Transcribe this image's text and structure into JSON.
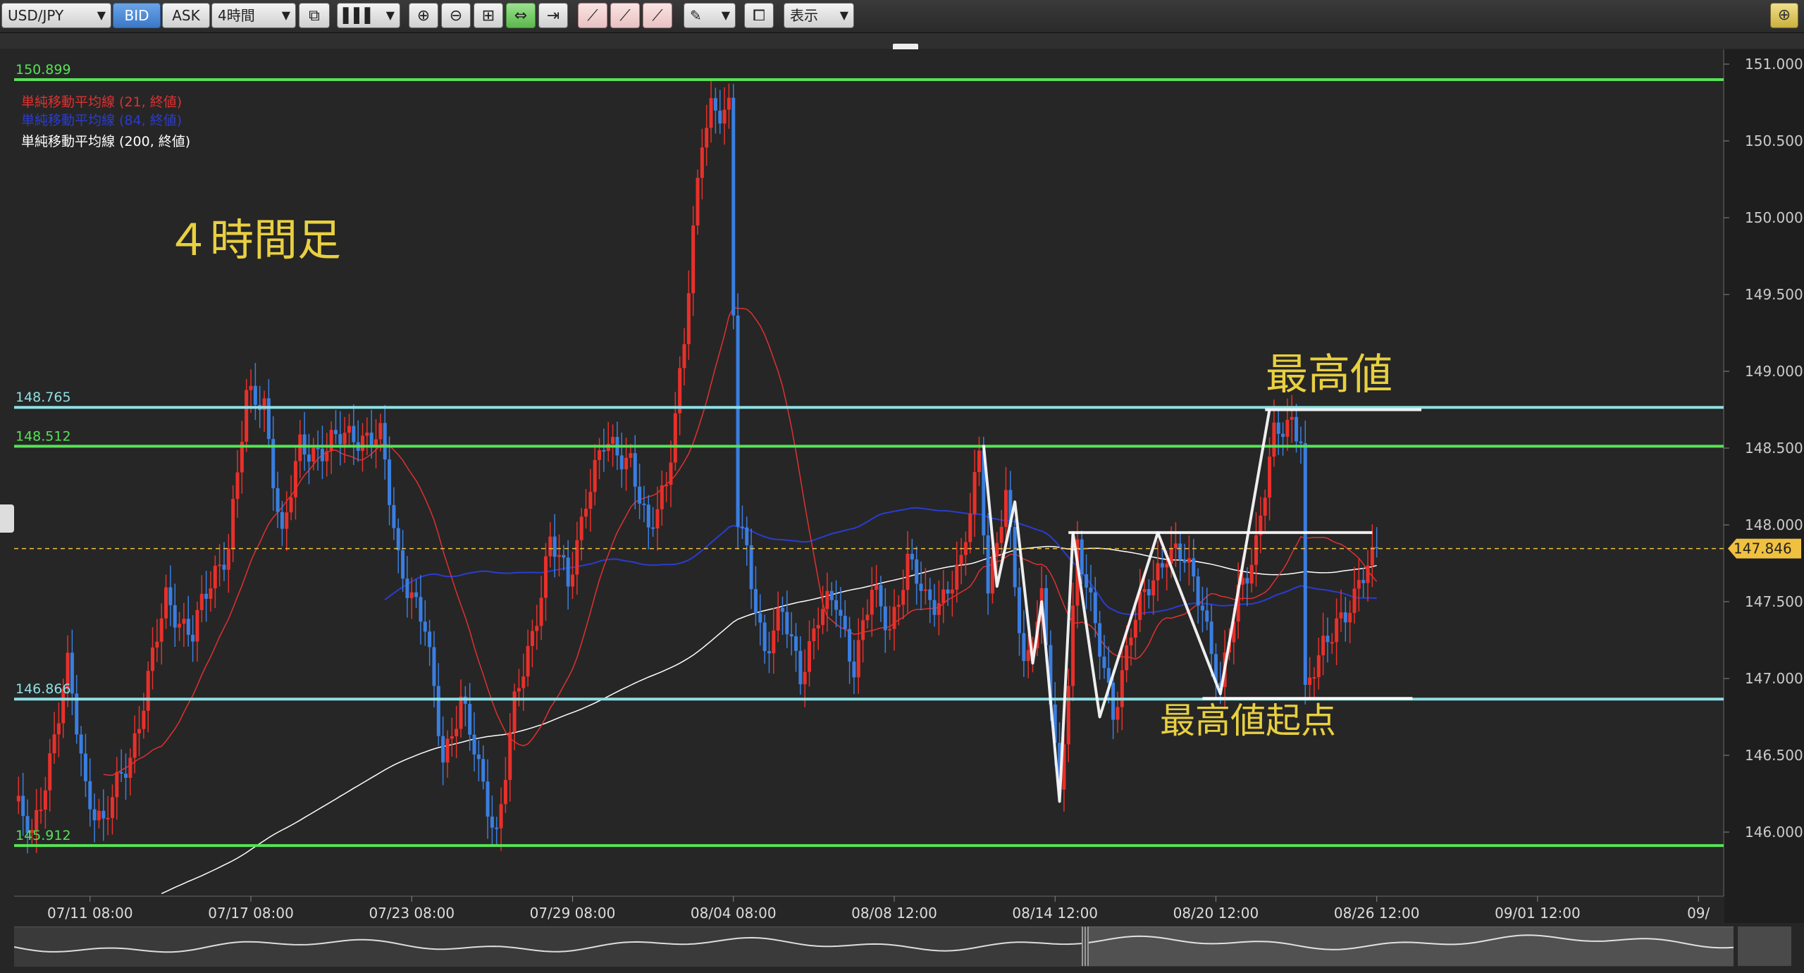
{
  "toolbar": {
    "symbol": "USD/JPY",
    "bid_label": "BID",
    "ask_label": "ASK",
    "timeframe": "4時間",
    "display_label": "表示",
    "icons": [
      "compare-icon",
      "chart-type-icon",
      "zoom-in-icon",
      "zoom-out-icon",
      "fit-icon",
      "range-icon",
      "pan-icon",
      "draw-tool-icon",
      "draw-tool-icon",
      "draw-tool-icon",
      "pencil-icon",
      "screenshot-icon",
      "settings-icon"
    ]
  },
  "legend": [
    {
      "label": "単純移動平均線 (21, 終値)",
      "color": "#e03030"
    },
    {
      "label": "単純移動平均線 (84, 終値)",
      "color": "#2a3cd0"
    },
    {
      "label": "単純移動平均線 (200, 終値)",
      "color": "#ffffff"
    }
  ],
  "annotations": {
    "timeframe_title": "４時間足",
    "high_label": "最高値",
    "high_origin_label": "最高値起点"
  },
  "colors": {
    "bull": "#e8302a",
    "bear": "#3a7ee0",
    "level_green": "#56e356",
    "level_cyan": "#8ee0e4",
    "annotation_text": "#e8d040",
    "current_price": "#f0c040"
  },
  "chart_data": {
    "type": "candlestick",
    "pair": "USD/JPY",
    "timeframe": "4時間",
    "ylim": [
      145.6,
      151.0
    ],
    "y_ticks": [
      "151.000",
      "150.500",
      "150.000",
      "149.500",
      "149.000",
      "148.500",
      "148.000",
      "147.500",
      "147.000",
      "146.500",
      "146.000"
    ],
    "x_ticks": [
      {
        "label": "07/11 08:00",
        "bar": 17
      },
      {
        "label": "07/17 08:00",
        "bar": 53
      },
      {
        "label": "07/23 08:00",
        "bar": 89
      },
      {
        "label": "07/29 08:00",
        "bar": 125
      },
      {
        "label": "08/04 08:00",
        "bar": 161
      },
      {
        "label": "08/08 12:00",
        "bar": 197
      },
      {
        "label": "08/14 12:00",
        "bar": 233
      },
      {
        "label": "08/20 12:00",
        "bar": 269
      },
      {
        "label": "08/26 12:00",
        "bar": 305
      },
      {
        "label": "09/01 12:00",
        "bar": 341
      },
      {
        "label": "09/",
        "bar": 377
      }
    ],
    "horizontal_levels": [
      {
        "label": "150.899",
        "value": 150.899,
        "color": "green"
      },
      {
        "label": "148.765",
        "value": 148.765,
        "color": "cyan"
      },
      {
        "label": "148.512",
        "value": 148.512,
        "color": "green"
      },
      {
        "label": "146.866",
        "value": 146.866,
        "color": "cyan"
      },
      {
        "label": "145.912",
        "value": 145.912,
        "color": "green"
      }
    ],
    "current_price": {
      "label": "147.846",
      "value": 147.846
    },
    "anchors": [
      {
        "bar": 0,
        "price": 146.2
      },
      {
        "bar": 4,
        "price": 145.95
      },
      {
        "bar": 12,
        "price": 147.05
      },
      {
        "bar": 16,
        "price": 146.3
      },
      {
        "bar": 20,
        "price": 146.05
      },
      {
        "bar": 26,
        "price": 146.5
      },
      {
        "bar": 34,
        "price": 147.5
      },
      {
        "bar": 40,
        "price": 147.3
      },
      {
        "bar": 48,
        "price": 147.9
      },
      {
        "bar": 52,
        "price": 148.8
      },
      {
        "bar": 56,
        "price": 148.8
      },
      {
        "bar": 60,
        "price": 147.9
      },
      {
        "bar": 64,
        "price": 148.5
      },
      {
        "bar": 70,
        "price": 148.5
      },
      {
        "bar": 76,
        "price": 148.6
      },
      {
        "bar": 82,
        "price": 148.55
      },
      {
        "bar": 86,
        "price": 147.8
      },
      {
        "bar": 92,
        "price": 147.3
      },
      {
        "bar": 96,
        "price": 146.5
      },
      {
        "bar": 100,
        "price": 146.85
      },
      {
        "bar": 104,
        "price": 146.4
      },
      {
        "bar": 108,
        "price": 146.0
      },
      {
        "bar": 112,
        "price": 146.8
      },
      {
        "bar": 116,
        "price": 147.3
      },
      {
        "bar": 120,
        "price": 147.9
      },
      {
        "bar": 124,
        "price": 147.6
      },
      {
        "bar": 128,
        "price": 148.2
      },
      {
        "bar": 132,
        "price": 148.5
      },
      {
        "bar": 138,
        "price": 148.45
      },
      {
        "bar": 142,
        "price": 147.9
      },
      {
        "bar": 146,
        "price": 148.3
      },
      {
        "bar": 150,
        "price": 149.2
      },
      {
        "bar": 154,
        "price": 150.5
      },
      {
        "bar": 156,
        "price": 150.75
      },
      {
        "bar": 160,
        "price": 150.7
      },
      {
        "bar": 162,
        "price": 148.0
      },
      {
        "bar": 164,
        "price": 147.8
      },
      {
        "bar": 168,
        "price": 147.2
      },
      {
        "bar": 172,
        "price": 147.4
      },
      {
        "bar": 176,
        "price": 147.05
      },
      {
        "bar": 180,
        "price": 147.4
      },
      {
        "bar": 184,
        "price": 147.5
      },
      {
        "bar": 188,
        "price": 147.1
      },
      {
        "bar": 192,
        "price": 147.55
      },
      {
        "bar": 196,
        "price": 147.35
      },
      {
        "bar": 200,
        "price": 147.75
      },
      {
        "bar": 204,
        "price": 147.5
      },
      {
        "bar": 208,
        "price": 147.55
      },
      {
        "bar": 212,
        "price": 147.7
      },
      {
        "bar": 216,
        "price": 148.5
      },
      {
        "bar": 218,
        "price": 147.6
      },
      {
        "bar": 222,
        "price": 148.15
      },
      {
        "bar": 226,
        "price": 147.1
      },
      {
        "bar": 230,
        "price": 147.5
      },
      {
        "bar": 234,
        "price": 146.2
      },
      {
        "bar": 238,
        "price": 147.9
      },
      {
        "bar": 242,
        "price": 147.3
      },
      {
        "bar": 246,
        "price": 146.8
      },
      {
        "bar": 250,
        "price": 147.3
      },
      {
        "bar": 254,
        "price": 147.6
      },
      {
        "bar": 258,
        "price": 147.85
      },
      {
        "bar": 262,
        "price": 147.75
      },
      {
        "bar": 266,
        "price": 147.5
      },
      {
        "bar": 270,
        "price": 146.9
      },
      {
        "bar": 274,
        "price": 147.55
      },
      {
        "bar": 278,
        "price": 147.9
      },
      {
        "bar": 282,
        "price": 148.55
      },
      {
        "bar": 286,
        "price": 148.7
      },
      {
        "bar": 288,
        "price": 148.6
      },
      {
        "bar": 289,
        "price": 146.9
      },
      {
        "bar": 292,
        "price": 147.1
      },
      {
        "bar": 296,
        "price": 147.4
      },
      {
        "bar": 300,
        "price": 147.5
      },
      {
        "bar": 305,
        "price": 147.85
      }
    ],
    "annotation_lines": [
      {
        "color": "#ffffff",
        "points": [
          [
            217,
            148.52
          ],
          [
            220,
            147.6
          ],
          [
            224,
            148.15
          ],
          [
            228,
            147.1
          ],
          [
            230,
            147.5
          ],
          [
            234,
            146.2
          ],
          [
            237,
            147.95
          ],
          [
            243,
            146.75
          ],
          [
            256,
            147.95
          ],
          [
            270,
            146.9
          ],
          [
            281,
            148.75
          ]
        ]
      },
      {
        "color": "#ffffff",
        "points": [
          [
            236,
            147.95
          ],
          [
            304,
            147.95
          ]
        ]
      },
      {
        "color": "#ffffff",
        "points": [
          [
            280,
            148.75
          ],
          [
            315,
            148.75
          ]
        ]
      },
      {
        "color": "#ffffff",
        "points": [
          [
            266,
            146.87
          ],
          [
            313,
            146.87
          ]
        ]
      }
    ]
  }
}
